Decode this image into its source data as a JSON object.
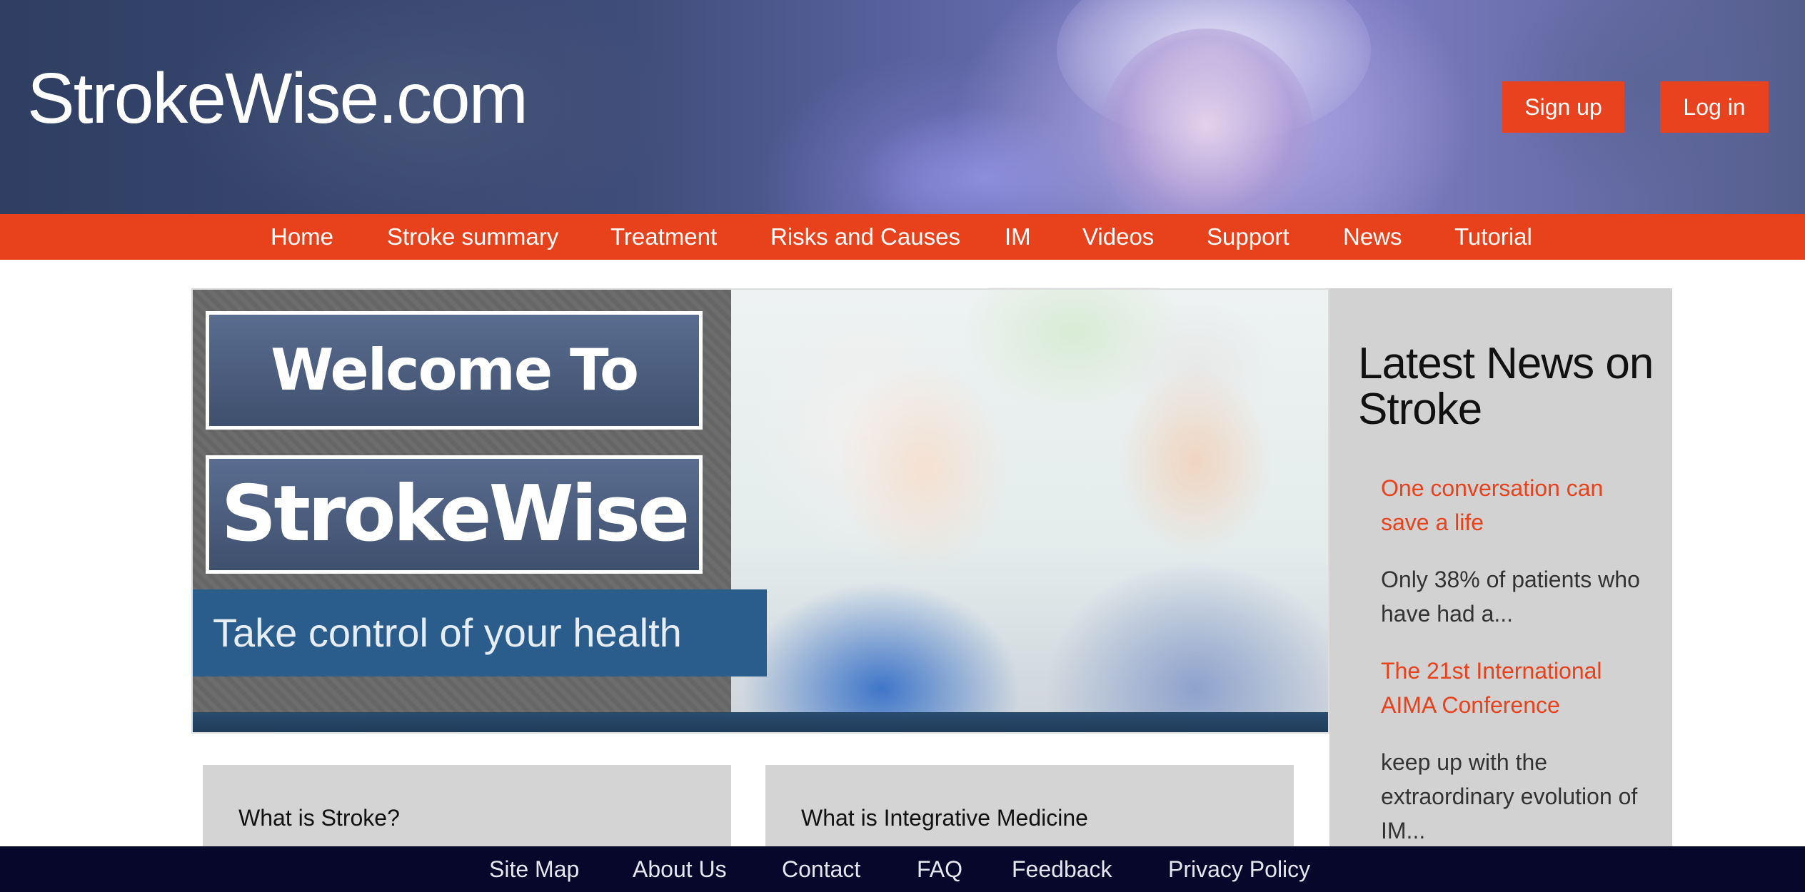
{
  "header": {
    "site_title": "StrokeWise.com",
    "signup_label": "Sign up",
    "login_label": "Log in"
  },
  "nav": {
    "items": [
      {
        "label": "Home"
      },
      {
        "label": "Stroke summary"
      },
      {
        "label": "Treatment"
      },
      {
        "label": "Risks and Causes"
      },
      {
        "label": "IM"
      },
      {
        "label": "Videos"
      },
      {
        "label": "Support"
      },
      {
        "label": "News"
      },
      {
        "label": "Tutorial"
      }
    ]
  },
  "hero": {
    "welcome_text": "Welcome To",
    "brand_text": "StrokeWise",
    "tagline": "Take control of your health"
  },
  "sidebar": {
    "heading": "Latest News on Stroke",
    "news": [
      {
        "title": "One conversation can save a life",
        "snippet": "Only 38% of patients who have had a..."
      },
      {
        "title": "The 21st International AIMA Conference",
        "snippet": "keep up with the extraordinary evolution of IM..."
      }
    ]
  },
  "cards": [
    {
      "title": "What is Stroke?"
    },
    {
      "title": "What is Integrative Medicine"
    }
  ],
  "footer": {
    "links": [
      {
        "label": "Site Map"
      },
      {
        "label": "About Us"
      },
      {
        "label": "Contact"
      },
      {
        "label": "FAQ"
      },
      {
        "label": "Feedback"
      },
      {
        "label": "Privacy Policy"
      }
    ]
  },
  "colors": {
    "accent": "#e8421d",
    "footer_bg": "#07062b",
    "sidebar_bg": "#d2d2d2"
  }
}
